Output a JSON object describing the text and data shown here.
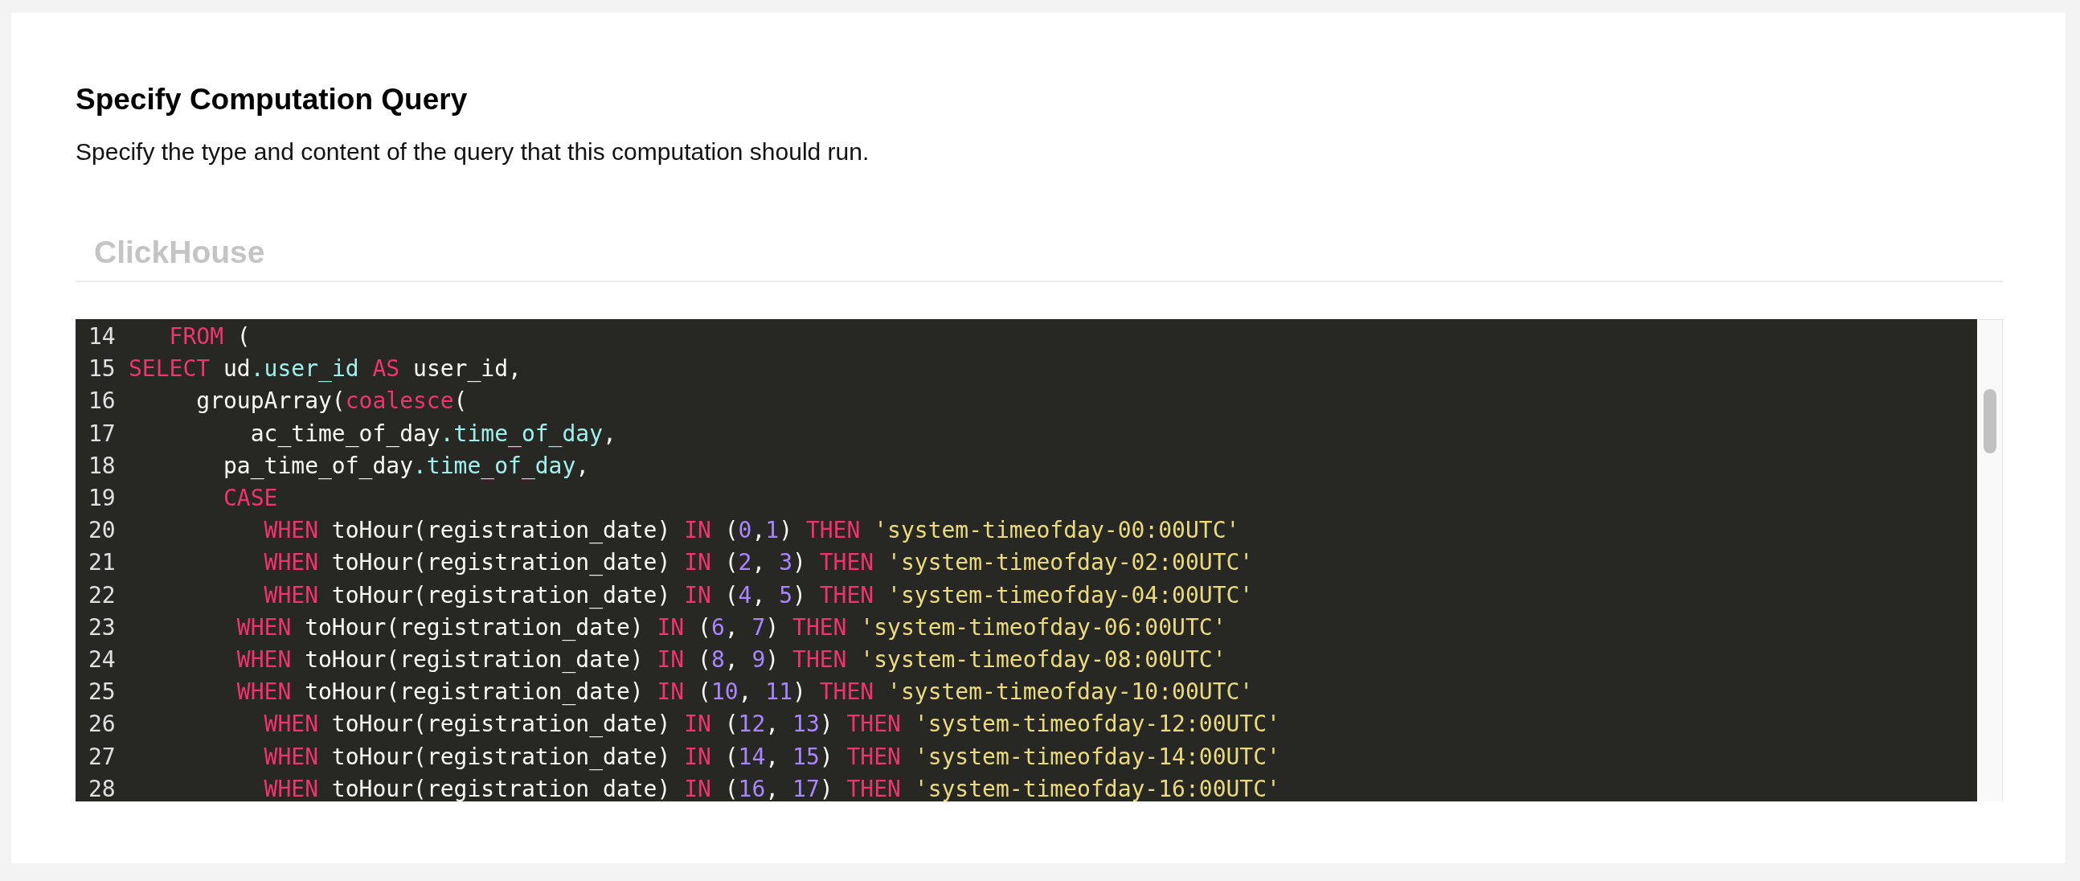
{
  "title": "Specify Computation Query",
  "description": "Specify the type and content of the query that this computation should run.",
  "tabs": [
    {
      "label": "ClickHouse",
      "selected": false
    }
  ],
  "editor": {
    "lines": [
      {
        "number": "14",
        "tokens": [
          {
            "kind": "keyword",
            "text": "   FROM"
          },
          {
            "kind": "plain",
            "text": " ("
          }
        ]
      },
      {
        "number": "15",
        "tokens": [
          {
            "kind": "keyword",
            "text": "SELECT"
          },
          {
            "kind": "plain",
            "text": " ud"
          },
          {
            "kind": "property",
            "text": ".user_id"
          },
          {
            "kind": "keyword",
            "text": " AS"
          },
          {
            "kind": "plain",
            "text": " user_id,"
          }
        ]
      },
      {
        "number": "16",
        "tokens": [
          {
            "kind": "plain",
            "text": "     groupArray("
          },
          {
            "kind": "keyword",
            "text": "coalesce"
          },
          {
            "kind": "plain",
            "text": "("
          }
        ]
      },
      {
        "number": "17",
        "tokens": [
          {
            "kind": "plain",
            "text": "         ac_time_of_day"
          },
          {
            "kind": "property",
            "text": ".time_of_day"
          },
          {
            "kind": "plain",
            "text": ","
          }
        ]
      },
      {
        "number": "18",
        "tokens": [
          {
            "kind": "plain",
            "text": "       pa_time_of_day"
          },
          {
            "kind": "property",
            "text": ".time_of_day"
          },
          {
            "kind": "plain",
            "text": ","
          }
        ]
      },
      {
        "number": "19",
        "tokens": [
          {
            "kind": "keyword",
            "text": "       CASE"
          }
        ]
      },
      {
        "number": "20",
        "tokens": [
          {
            "kind": "keyword",
            "text": "          WHEN"
          },
          {
            "kind": "plain",
            "text": " toHour(registration_date) "
          },
          {
            "kind": "keyword",
            "text": "IN"
          },
          {
            "kind": "plain",
            "text": " ("
          },
          {
            "kind": "number",
            "text": "0"
          },
          {
            "kind": "plain",
            "text": ","
          },
          {
            "kind": "number",
            "text": "1"
          },
          {
            "kind": "plain",
            "text": ") "
          },
          {
            "kind": "keyword",
            "text": "THEN"
          },
          {
            "kind": "string",
            "text": " 'system-timeofday-00:00UTC'"
          }
        ]
      },
      {
        "number": "21",
        "tokens": [
          {
            "kind": "keyword",
            "text": "          WHEN"
          },
          {
            "kind": "plain",
            "text": " toHour(registration_date) "
          },
          {
            "kind": "keyword",
            "text": "IN"
          },
          {
            "kind": "plain",
            "text": " ("
          },
          {
            "kind": "number",
            "text": "2"
          },
          {
            "kind": "plain",
            "text": ", "
          },
          {
            "kind": "number",
            "text": "3"
          },
          {
            "kind": "plain",
            "text": ") "
          },
          {
            "kind": "keyword",
            "text": "THEN"
          },
          {
            "kind": "string",
            "text": " 'system-timeofday-02:00UTC'"
          }
        ]
      },
      {
        "number": "22",
        "tokens": [
          {
            "kind": "keyword",
            "text": "          WHEN"
          },
          {
            "kind": "plain",
            "text": " toHour(registration_date) "
          },
          {
            "kind": "keyword",
            "text": "IN"
          },
          {
            "kind": "plain",
            "text": " ("
          },
          {
            "kind": "number",
            "text": "4"
          },
          {
            "kind": "plain",
            "text": ", "
          },
          {
            "kind": "number",
            "text": "5"
          },
          {
            "kind": "plain",
            "text": ") "
          },
          {
            "kind": "keyword",
            "text": "THEN"
          },
          {
            "kind": "string",
            "text": " 'system-timeofday-04:00UTC'"
          }
        ]
      },
      {
        "number": "23",
        "tokens": [
          {
            "kind": "keyword",
            "text": "        WHEN"
          },
          {
            "kind": "plain",
            "text": " toHour(registration_date) "
          },
          {
            "kind": "keyword",
            "text": "IN"
          },
          {
            "kind": "plain",
            "text": " ("
          },
          {
            "kind": "number",
            "text": "6"
          },
          {
            "kind": "plain",
            "text": ", "
          },
          {
            "kind": "number",
            "text": "7"
          },
          {
            "kind": "plain",
            "text": ") "
          },
          {
            "kind": "keyword",
            "text": "THEN"
          },
          {
            "kind": "string",
            "text": " 'system-timeofday-06:00UTC'"
          }
        ]
      },
      {
        "number": "24",
        "tokens": [
          {
            "kind": "keyword",
            "text": "        WHEN"
          },
          {
            "kind": "plain",
            "text": " toHour(registration_date) "
          },
          {
            "kind": "keyword",
            "text": "IN"
          },
          {
            "kind": "plain",
            "text": " ("
          },
          {
            "kind": "number",
            "text": "8"
          },
          {
            "kind": "plain",
            "text": ", "
          },
          {
            "kind": "number",
            "text": "9"
          },
          {
            "kind": "plain",
            "text": ") "
          },
          {
            "kind": "keyword",
            "text": "THEN"
          },
          {
            "kind": "string",
            "text": " 'system-timeofday-08:00UTC'"
          }
        ]
      },
      {
        "number": "25",
        "tokens": [
          {
            "kind": "keyword",
            "text": "        WHEN"
          },
          {
            "kind": "plain",
            "text": " toHour(registration_date) "
          },
          {
            "kind": "keyword",
            "text": "IN"
          },
          {
            "kind": "plain",
            "text": " ("
          },
          {
            "kind": "number",
            "text": "10"
          },
          {
            "kind": "plain",
            "text": ", "
          },
          {
            "kind": "number",
            "text": "11"
          },
          {
            "kind": "plain",
            "text": ") "
          },
          {
            "kind": "keyword",
            "text": "THEN"
          },
          {
            "kind": "string",
            "text": " 'system-timeofday-10:00UTC'"
          }
        ]
      },
      {
        "number": "26",
        "tokens": [
          {
            "kind": "keyword",
            "text": "          WHEN"
          },
          {
            "kind": "plain",
            "text": " toHour(registration_date) "
          },
          {
            "kind": "keyword",
            "text": "IN"
          },
          {
            "kind": "plain",
            "text": " ("
          },
          {
            "kind": "number",
            "text": "12"
          },
          {
            "kind": "plain",
            "text": ", "
          },
          {
            "kind": "number",
            "text": "13"
          },
          {
            "kind": "plain",
            "text": ") "
          },
          {
            "kind": "keyword",
            "text": "THEN"
          },
          {
            "kind": "string",
            "text": " 'system-timeofday-12:00UTC'"
          }
        ]
      },
      {
        "number": "27",
        "tokens": [
          {
            "kind": "keyword",
            "text": "          WHEN"
          },
          {
            "kind": "plain",
            "text": " toHour(registration_date) "
          },
          {
            "kind": "keyword",
            "text": "IN"
          },
          {
            "kind": "plain",
            "text": " ("
          },
          {
            "kind": "number",
            "text": "14"
          },
          {
            "kind": "plain",
            "text": ", "
          },
          {
            "kind": "number",
            "text": "15"
          },
          {
            "kind": "plain",
            "text": ") "
          },
          {
            "kind": "keyword",
            "text": "THEN"
          },
          {
            "kind": "string",
            "text": " 'system-timeofday-14:00UTC'"
          }
        ]
      },
      {
        "number": "28",
        "tokens": [
          {
            "kind": "keyword",
            "text": "          WHEN"
          },
          {
            "kind": "plain",
            "text": " toHour(registration_date) "
          },
          {
            "kind": "keyword",
            "text": "IN"
          },
          {
            "kind": "plain",
            "text": " ("
          },
          {
            "kind": "number",
            "text": "16"
          },
          {
            "kind": "plain",
            "text": ", "
          },
          {
            "kind": "number",
            "text": "17"
          },
          {
            "kind": "plain",
            "text": ") "
          },
          {
            "kind": "keyword",
            "text": "THEN"
          },
          {
            "kind": "string",
            "text": " 'system-timeofday-16:00UTC'"
          }
        ]
      }
    ]
  }
}
